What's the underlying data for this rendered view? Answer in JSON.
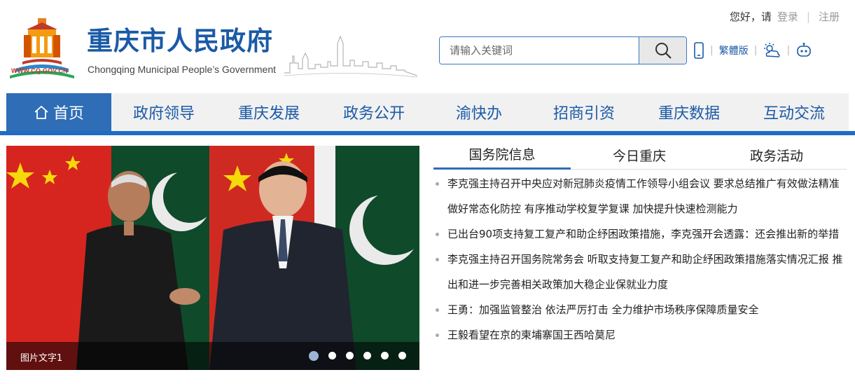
{
  "header": {
    "site_title": "重庆市人民政府",
    "site_subtitle": "Chongqing Municipal People’s Government",
    "logo_url": "WWW.CQ.GOV.CN",
    "greeting": "您好，请",
    "login": "登录",
    "register": "注册",
    "search_placeholder": "请输入关键词",
    "traditional": "繁體版",
    "icons": [
      "mobile-icon",
      "weather-icon",
      "robot-icon",
      "search-icon"
    ]
  },
  "nav": {
    "items": [
      {
        "label": "首页"
      },
      {
        "label": "政府领导"
      },
      {
        "label": "重庆发展"
      },
      {
        "label": "政务公开"
      },
      {
        "label": "渝快办"
      },
      {
        "label": "招商引资"
      },
      {
        "label": "重庆数据"
      },
      {
        "label": "互动交流"
      }
    ]
  },
  "carousel": {
    "caption": "图片文字1",
    "slide_count": 6,
    "active_index": 0
  },
  "tabs": [
    {
      "label": "国务院信息"
    },
    {
      "label": "今日重庆"
    },
    {
      "label": "政务活动"
    }
  ],
  "news": [
    "李克强主持召开中央应对新冠肺炎疫情工作领导小组会议 要求总结推广有效做法精准做好常态化防控 有序推动学校复学复课 加快提升快速检测能力",
    "已出台90项支持复工复产和助企纾困政策措施，李克强开会透露：还会推出新的举措",
    "李克强主持召开国务院常务会 听取支持复工复产和助企纾困政策措施落实情况汇报 推出和进一步完善相关政策加大稳企业保就业力度",
    "王勇：加强监管整治 依法严厉打击 全力维护市场秩序保障质量安全",
    "王毅看望在京的柬埔寨国王西哈莫尼"
  ],
  "colors": {
    "brand": "#1a5aa6",
    "nav_active": "#2f6db6",
    "nav_bg": "#f1f1f1"
  }
}
